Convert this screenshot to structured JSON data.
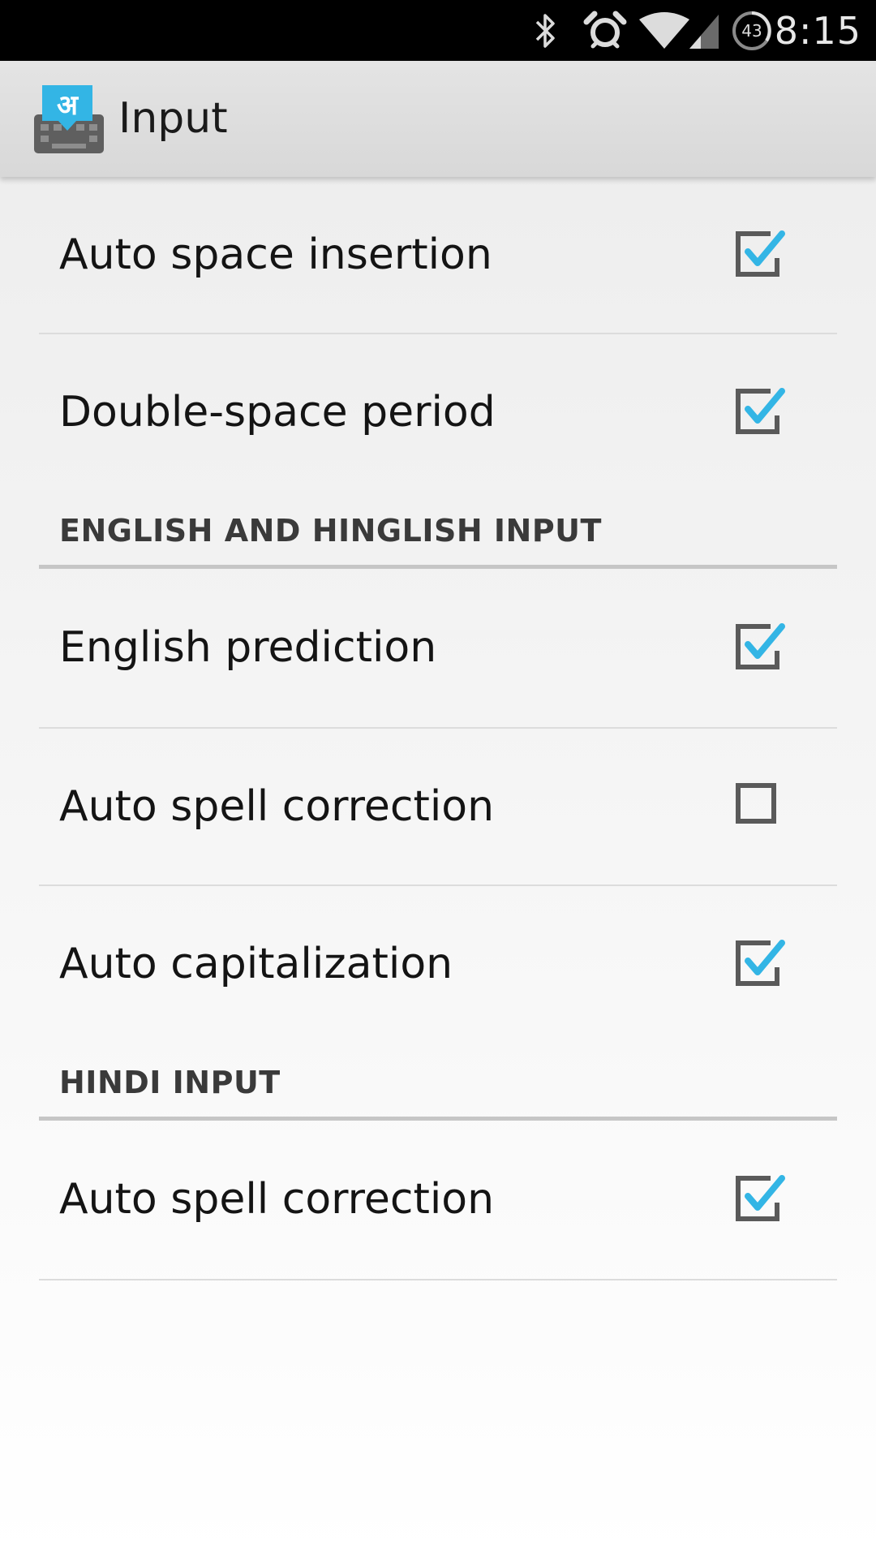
{
  "status_bar": {
    "time": "8:15",
    "battery_level": "43",
    "icons": [
      "bluetooth-icon",
      "alarm-icon",
      "wifi-icon",
      "cell-signal-icon",
      "battery-icon"
    ]
  },
  "action_bar": {
    "title": "Input",
    "app_icon": "hindi-keyboard-icon",
    "app_icon_glyph": "अ"
  },
  "colors": {
    "accent": "#33b5e5",
    "checkbox_border": "#5a5a5a",
    "status_bar_bg": "#000000"
  },
  "general": {
    "items": [
      {
        "label": "Auto space insertion",
        "checked": true
      },
      {
        "label": "Double-space period",
        "checked": true
      }
    ]
  },
  "english_section": {
    "header": "ENGLISH AND HINGLISH INPUT",
    "items": [
      {
        "label": "English prediction",
        "checked": true
      },
      {
        "label": "Auto spell correction",
        "checked": false
      },
      {
        "label": "Auto capitalization",
        "checked": true
      }
    ]
  },
  "hindi_section": {
    "header": "HINDI INPUT",
    "items": [
      {
        "label": "Auto spell correction",
        "checked": true
      }
    ]
  }
}
